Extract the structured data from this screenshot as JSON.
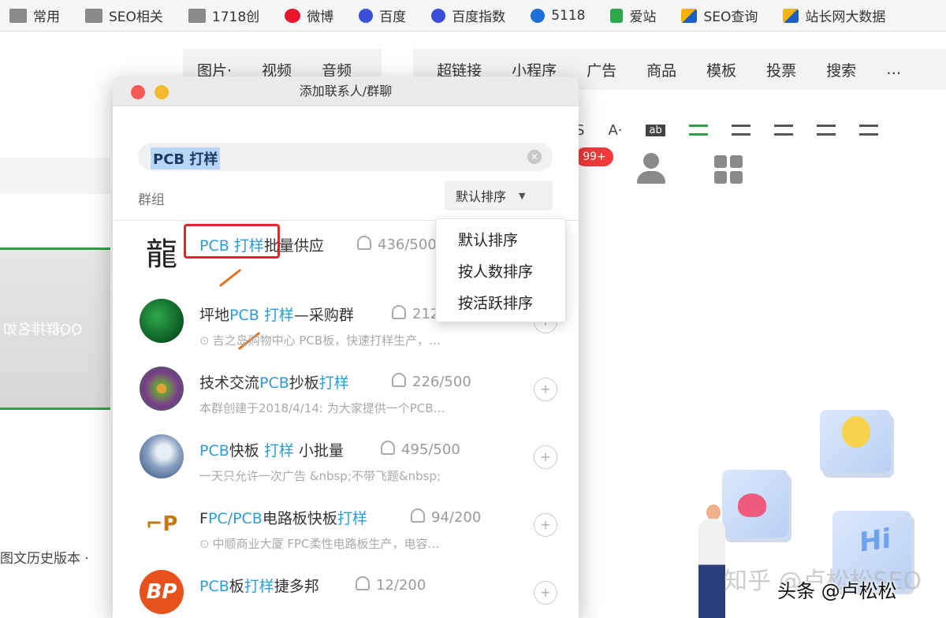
{
  "bookmarks": [
    {
      "label": "常用",
      "icon": "folder-icon"
    },
    {
      "label": "SEO相关",
      "icon": "folder-icon"
    },
    {
      "label": "1718创",
      "icon": "folder-icon"
    },
    {
      "label": "微博",
      "icon": "weibo-icon"
    },
    {
      "label": "百度",
      "icon": "baidu-icon"
    },
    {
      "label": "百度指数",
      "icon": "baidu-icon"
    },
    {
      "label": "5118",
      "icon": "5118-icon"
    },
    {
      "label": "爱站",
      "icon": "aizhan-icon"
    },
    {
      "label": "SEO查询",
      "icon": "seo-icon"
    },
    {
      "label": "站长网大数据",
      "icon": "seo-icon"
    }
  ],
  "editor": {
    "toolbar_left": [
      "图片·",
      "视频",
      "音频"
    ],
    "toolbar_right": [
      "超链接",
      "小程序",
      "广告",
      "商品",
      "模板",
      "投票",
      "搜索",
      "…"
    ],
    "format_a": "A·",
    "format_ab": "ab",
    "format_s": "S",
    "left_panel_text": "QQ群排名如",
    "left_bottom_text": "图文历史版本 ·",
    "badge": "99+",
    "watermark": "知乎 @卢松松SEO",
    "byline": "头条 @卢松松"
  },
  "dialog": {
    "title": "添加联系人/群聊",
    "search_value": "PCB 打样",
    "section_label": "群组",
    "sort_label": "默认排序",
    "sort_options": [
      "默认排序",
      "按人数排序",
      "按活跃排序"
    ],
    "results": [
      {
        "name_parts": [
          [
            "PCB 打样",
            true
          ],
          [
            "批量供应",
            false
          ]
        ],
        "count": "436/500",
        "sub": ""
      },
      {
        "name_parts": [
          [
            "坪地",
            false
          ],
          [
            "PCB 打样",
            true
          ],
          [
            "—采购群",
            false
          ]
        ],
        "count": "212",
        "sub": "吉之岛购物中心  PCB板，快速打样生产，…"
      },
      {
        "name_parts": [
          [
            "技术交流",
            false
          ],
          [
            "PCB",
            true
          ],
          [
            "抄板",
            false
          ],
          [
            "打样",
            true
          ]
        ],
        "count": "226/500",
        "sub": "本群创建于2018/4/14: 为大家提供一个PCB…"
      },
      {
        "name_parts": [
          [
            "PCB",
            true
          ],
          [
            "快板 ",
            false
          ],
          [
            "打样",
            true
          ],
          [
            " 小批量",
            false
          ]
        ],
        "count": "495/500",
        "sub": "一天只允许一次广告 &nbsp;不带飞题&nbsp;"
      },
      {
        "name_parts": [
          [
            "F",
            false
          ],
          [
            "PC",
            true
          ],
          [
            "/",
            false
          ],
          [
            "PCB",
            true
          ],
          [
            "电路板快板",
            false
          ],
          [
            "打样",
            true
          ]
        ],
        "count": "94/200",
        "sub": "中顺商业大厦  FPC柔性电路板生产，电容…"
      },
      {
        "name_parts": [
          [
            "PCB",
            true
          ],
          [
            "板",
            false
          ],
          [
            "打样",
            true
          ],
          [
            "捷多邦",
            false
          ]
        ],
        "count": "12/200",
        "sub": ""
      }
    ]
  }
}
